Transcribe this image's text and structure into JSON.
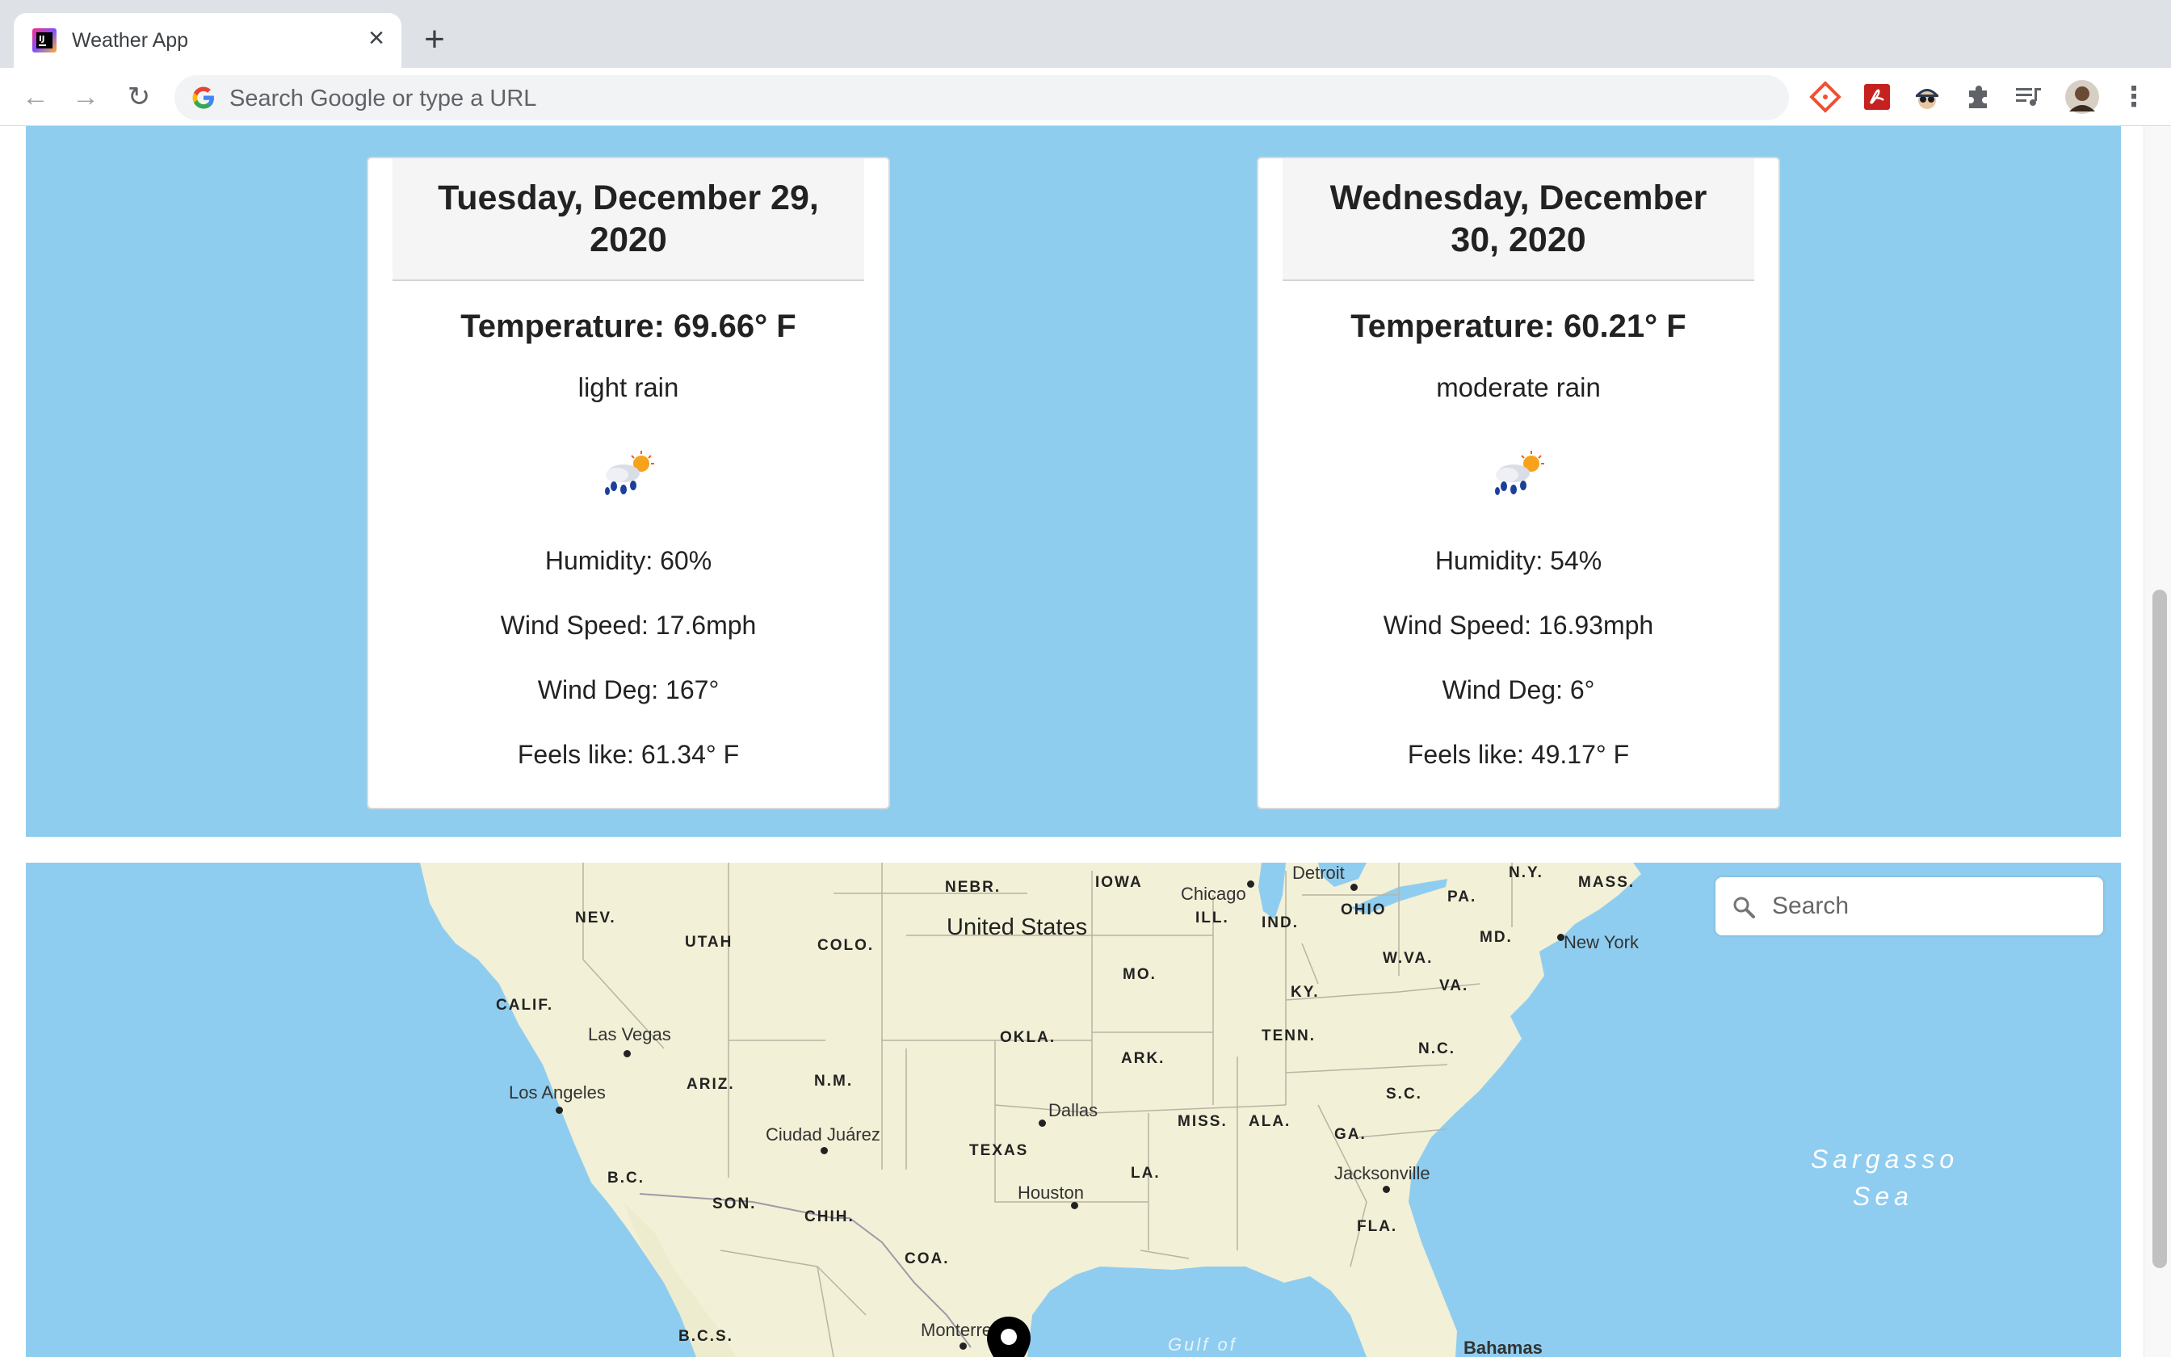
{
  "browser": {
    "tab_title": "Weather App",
    "tab_close": "×",
    "new_tab": "+",
    "omnibox_placeholder": "Search Google or type a URL",
    "back": "←",
    "forward": "→",
    "reload": "↻",
    "menu": "⋮",
    "extensions": [
      "git-icon",
      "pdf-icon",
      "spy-icon",
      "puzzle-icon",
      "playlist-icon",
      "avatar"
    ]
  },
  "forecast": {
    "background_color": "#8ecdee",
    "cards": [
      {
        "date": "Tuesday, December 29, 2020",
        "temperature": "Temperature: 69.66° F",
        "description": "light rain",
        "icon": "rain-sun-icon",
        "humidity": "Humidity: 60%",
        "wind_speed": "Wind Speed: 17.6mph",
        "wind_deg": "Wind Deg: 167°",
        "feels_like": "Feels like: 61.34° F"
      },
      {
        "date": "Wednesday, December 30, 2020",
        "temperature": "Temperature: 60.21° F",
        "description": "moderate rain",
        "icon": "rain-sun-icon",
        "humidity": "Humidity: 54%",
        "wind_speed": "Wind Speed: 16.93mph",
        "wind_deg": "Wind Deg: 6°",
        "feels_like": "Feels like: 49.17° F"
      }
    ]
  },
  "map": {
    "search_placeholder": "Search",
    "country": "United States",
    "states": [
      "NEBR.",
      "IOWA",
      "NEV.",
      "UTAH",
      "COLO.",
      "ILL.",
      "IND.",
      "OHIO",
      "PA.",
      "N.Y.",
      "MASS.",
      "MD.",
      "W.VA.",
      "VA.",
      "CALIF.",
      "MO.",
      "KY.",
      "OKLA.",
      "TENN.",
      "N.C.",
      "ARK.",
      "ARIZ.",
      "N.M.",
      "S.C.",
      "MISS.",
      "ALA.",
      "GA.",
      "TEXAS",
      "LA.",
      "B.C.",
      "SON.",
      "CHIH.",
      "FLA.",
      "COA.",
      "B.C.S."
    ],
    "cities": [
      "Detroit",
      "Chicago",
      "New York",
      "Las Vegas",
      "Los Angeles",
      "Dallas",
      "Ciudad Juárez",
      "Houston",
      "Jacksonville",
      "Monterrey",
      "Bahamas"
    ],
    "seas": [
      "Sargasso",
      "Sea",
      "Gulf of"
    ],
    "land_color": "#f2f0d6",
    "water_color": "#8fcdf0",
    "pin_icon": "map-marker-icon"
  }
}
